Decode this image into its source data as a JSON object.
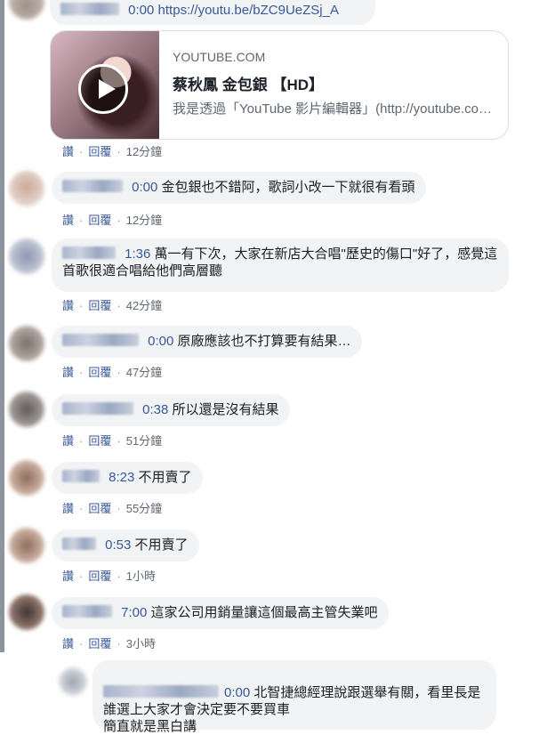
{
  "thread": {
    "first": {
      "ts": "0:00",
      "link": "https://youtu.be/bZC9UeZSj_A"
    },
    "card": {
      "domain": "YOUTUBE.COM",
      "title": "蔡秋鳳 金包銀 【HD】",
      "desc": "我是透過「YouTube 影片編輯器」(http://youtube.com/editor) 建立這部影片"
    },
    "labels": {
      "like": "讚",
      "reply": "回覆",
      "sep": "·"
    },
    "times": [
      "12分鐘",
      "12分鐘",
      "42分鐘",
      "47分鐘",
      "51分鐘",
      "55分鐘",
      "1小時",
      "3小時"
    ],
    "comments": [
      {
        "ts": "0:00",
        "text": "金包銀也不錯阿，歌詞小改一下就很有看頭"
      },
      {
        "ts": "1:36",
        "text": "萬一有下次，大家在新店大合唱\"歷史的傷口\"好了，感覺這首歌很適合唱給他們高層聽"
      },
      {
        "ts": "0:00",
        "text": "原廠應該也不打算要有結果…"
      },
      {
        "ts": "0:38",
        "text": "所以還是沒有結果"
      },
      {
        "ts": "8:23",
        "text": "不用賣了"
      },
      {
        "ts": "0:53",
        "text": "不用賣了"
      },
      {
        "ts": "7:00",
        "text": "這家公司用銷量讓這個最高主管失業吧"
      }
    ],
    "reply": {
      "ts": "0:00",
      "text": "北智捷總經理說跟選舉有關，看里長是誰選上大家才會決定要不要買車\n簡直就是黑白講"
    }
  },
  "colors": {
    "bubble": "#f2f3f5",
    "link": "#385898",
    "text": "#1c1e21"
  }
}
